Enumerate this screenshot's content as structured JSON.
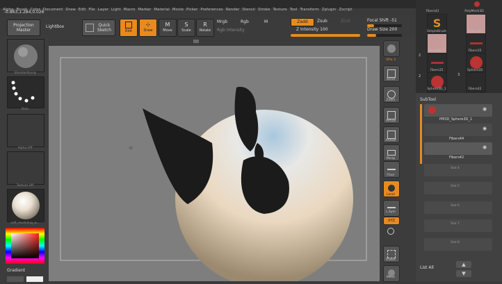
{
  "menu": [
    "Alpha",
    "Brush",
    "Color",
    "Document",
    "Draw",
    "Edit",
    "File",
    "Layer",
    "Light",
    "Macro",
    "Marker",
    "Material",
    "Movie",
    "Picker",
    "Preferences",
    "Render",
    "Stencil",
    "Stroke",
    "Texture",
    "Tool",
    "Transform",
    "Zplugin",
    "Zscript"
  ],
  "coords": "-0.863,1.284,0.026",
  "toolbar": {
    "projection_master": "Projection Master",
    "lightbox": "LightBox",
    "quick_sketch": "Quick Sketch",
    "edit": "Edit",
    "draw": "Draw",
    "move": "Move",
    "scale": "Scale",
    "rotate": "Rotate",
    "mrgb": "Mrgb",
    "rgb": "Rgb",
    "m": "M",
    "rgb_intensity": "Rgb Intensity",
    "zadd": "Zadd",
    "zsub": "Zsub",
    "zcut": "Zcut",
    "z_intensity_label": "Z Intensity",
    "z_intensity_value": "100",
    "focal_shift_label": "Focal Shift",
    "focal_shift_value": "-51",
    "draw_size_label": "Draw Size",
    "draw_size_value": "200"
  },
  "left": {
    "brush_label": "StandardLong",
    "stroke_label": "Dots",
    "alpha_label": "Alpha Off",
    "texture_label": "Texture Off",
    "material_label": "soft_modeling_w...",
    "gradient_label": "Gradient"
  },
  "right": {
    "spix": "SPix 3",
    "scroll": "Scroll",
    "zoom": "Zoom",
    "actual": "Actual",
    "aahalf": "AAHalf",
    "persp": "Persp",
    "floor": "Floor",
    "local": "Local",
    "lsym": "L.Sym",
    "xyz": "XYZ",
    "frame": "Frame",
    "move": "Move"
  },
  "toolpanel": {
    "tools": [
      {
        "label": "Fibers42"
      },
      {
        "label": "PolyMesh3D"
      },
      {
        "label": "SimpleBrush"
      },
      {
        "label": "Plane3D"
      },
      {
        "label": "Plane3D_1"
      },
      {
        "label": "Fibers35"
      },
      {
        "label": "Fibers35"
      },
      {
        "label": "Sphere3D"
      },
      {
        "label": "Sphere3D_1"
      },
      {
        "label": "Fibers42"
      }
    ],
    "counts": [
      "2",
      "2",
      "3"
    ],
    "subtool_title": "SubTool",
    "subtools": [
      {
        "name": "PM3D_Sphere3D_1"
      },
      {
        "name": "Fibers44"
      },
      {
        "name": "Fibers42"
      },
      {
        "name": "Slot 4"
      },
      {
        "name": "Slot 5"
      },
      {
        "name": "Slot 6"
      },
      {
        "name": "Slot 7"
      },
      {
        "name": "Slot 8"
      }
    ],
    "list_all": "List All"
  }
}
